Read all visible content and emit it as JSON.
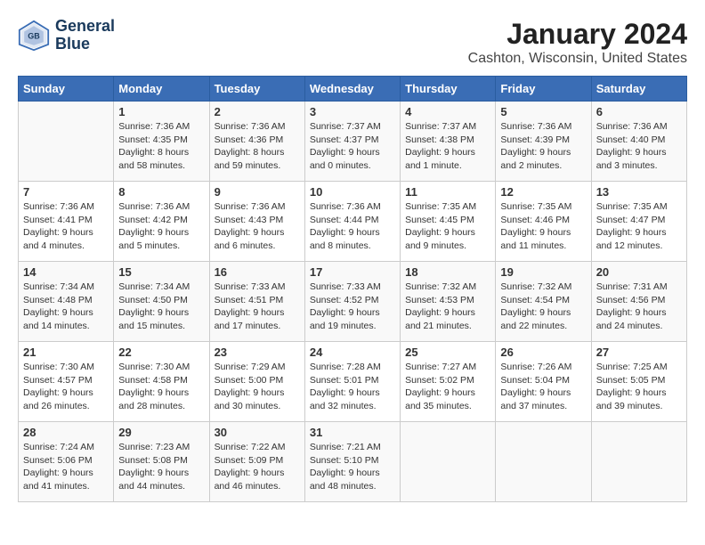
{
  "header": {
    "logo_line1": "General",
    "logo_line2": "Blue",
    "title": "January 2024",
    "subtitle": "Cashton, Wisconsin, United States"
  },
  "weekdays": [
    "Sunday",
    "Monday",
    "Tuesday",
    "Wednesday",
    "Thursday",
    "Friday",
    "Saturday"
  ],
  "weeks": [
    [
      {
        "day": "",
        "sunrise": "",
        "sunset": "",
        "daylight": ""
      },
      {
        "day": "1",
        "sunrise": "Sunrise: 7:36 AM",
        "sunset": "Sunset: 4:35 PM",
        "daylight": "Daylight: 8 hours and 58 minutes."
      },
      {
        "day": "2",
        "sunrise": "Sunrise: 7:36 AM",
        "sunset": "Sunset: 4:36 PM",
        "daylight": "Daylight: 8 hours and 59 minutes."
      },
      {
        "day": "3",
        "sunrise": "Sunrise: 7:37 AM",
        "sunset": "Sunset: 4:37 PM",
        "daylight": "Daylight: 9 hours and 0 minutes."
      },
      {
        "day": "4",
        "sunrise": "Sunrise: 7:37 AM",
        "sunset": "Sunset: 4:38 PM",
        "daylight": "Daylight: 9 hours and 1 minute."
      },
      {
        "day": "5",
        "sunrise": "Sunrise: 7:36 AM",
        "sunset": "Sunset: 4:39 PM",
        "daylight": "Daylight: 9 hours and 2 minutes."
      },
      {
        "day": "6",
        "sunrise": "Sunrise: 7:36 AM",
        "sunset": "Sunset: 4:40 PM",
        "daylight": "Daylight: 9 hours and 3 minutes."
      }
    ],
    [
      {
        "day": "7",
        "sunrise": "Sunrise: 7:36 AM",
        "sunset": "Sunset: 4:41 PM",
        "daylight": "Daylight: 9 hours and 4 minutes."
      },
      {
        "day": "8",
        "sunrise": "Sunrise: 7:36 AM",
        "sunset": "Sunset: 4:42 PM",
        "daylight": "Daylight: 9 hours and 5 minutes."
      },
      {
        "day": "9",
        "sunrise": "Sunrise: 7:36 AM",
        "sunset": "Sunset: 4:43 PM",
        "daylight": "Daylight: 9 hours and 6 minutes."
      },
      {
        "day": "10",
        "sunrise": "Sunrise: 7:36 AM",
        "sunset": "Sunset: 4:44 PM",
        "daylight": "Daylight: 9 hours and 8 minutes."
      },
      {
        "day": "11",
        "sunrise": "Sunrise: 7:35 AM",
        "sunset": "Sunset: 4:45 PM",
        "daylight": "Daylight: 9 hours and 9 minutes."
      },
      {
        "day": "12",
        "sunrise": "Sunrise: 7:35 AM",
        "sunset": "Sunset: 4:46 PM",
        "daylight": "Daylight: 9 hours and 11 minutes."
      },
      {
        "day": "13",
        "sunrise": "Sunrise: 7:35 AM",
        "sunset": "Sunset: 4:47 PM",
        "daylight": "Daylight: 9 hours and 12 minutes."
      }
    ],
    [
      {
        "day": "14",
        "sunrise": "Sunrise: 7:34 AM",
        "sunset": "Sunset: 4:48 PM",
        "daylight": "Daylight: 9 hours and 14 minutes."
      },
      {
        "day": "15",
        "sunrise": "Sunrise: 7:34 AM",
        "sunset": "Sunset: 4:50 PM",
        "daylight": "Daylight: 9 hours and 15 minutes."
      },
      {
        "day": "16",
        "sunrise": "Sunrise: 7:33 AM",
        "sunset": "Sunset: 4:51 PM",
        "daylight": "Daylight: 9 hours and 17 minutes."
      },
      {
        "day": "17",
        "sunrise": "Sunrise: 7:33 AM",
        "sunset": "Sunset: 4:52 PM",
        "daylight": "Daylight: 9 hours and 19 minutes."
      },
      {
        "day": "18",
        "sunrise": "Sunrise: 7:32 AM",
        "sunset": "Sunset: 4:53 PM",
        "daylight": "Daylight: 9 hours and 21 minutes."
      },
      {
        "day": "19",
        "sunrise": "Sunrise: 7:32 AM",
        "sunset": "Sunset: 4:54 PM",
        "daylight": "Daylight: 9 hours and 22 minutes."
      },
      {
        "day": "20",
        "sunrise": "Sunrise: 7:31 AM",
        "sunset": "Sunset: 4:56 PM",
        "daylight": "Daylight: 9 hours and 24 minutes."
      }
    ],
    [
      {
        "day": "21",
        "sunrise": "Sunrise: 7:30 AM",
        "sunset": "Sunset: 4:57 PM",
        "daylight": "Daylight: 9 hours and 26 minutes."
      },
      {
        "day": "22",
        "sunrise": "Sunrise: 7:30 AM",
        "sunset": "Sunset: 4:58 PM",
        "daylight": "Daylight: 9 hours and 28 minutes."
      },
      {
        "day": "23",
        "sunrise": "Sunrise: 7:29 AM",
        "sunset": "Sunset: 5:00 PM",
        "daylight": "Daylight: 9 hours and 30 minutes."
      },
      {
        "day": "24",
        "sunrise": "Sunrise: 7:28 AM",
        "sunset": "Sunset: 5:01 PM",
        "daylight": "Daylight: 9 hours and 32 minutes."
      },
      {
        "day": "25",
        "sunrise": "Sunrise: 7:27 AM",
        "sunset": "Sunset: 5:02 PM",
        "daylight": "Daylight: 9 hours and 35 minutes."
      },
      {
        "day": "26",
        "sunrise": "Sunrise: 7:26 AM",
        "sunset": "Sunset: 5:04 PM",
        "daylight": "Daylight: 9 hours and 37 minutes."
      },
      {
        "day": "27",
        "sunrise": "Sunrise: 7:25 AM",
        "sunset": "Sunset: 5:05 PM",
        "daylight": "Daylight: 9 hours and 39 minutes."
      }
    ],
    [
      {
        "day": "28",
        "sunrise": "Sunrise: 7:24 AM",
        "sunset": "Sunset: 5:06 PM",
        "daylight": "Daylight: 9 hours and 41 minutes."
      },
      {
        "day": "29",
        "sunrise": "Sunrise: 7:23 AM",
        "sunset": "Sunset: 5:08 PM",
        "daylight": "Daylight: 9 hours and 44 minutes."
      },
      {
        "day": "30",
        "sunrise": "Sunrise: 7:22 AM",
        "sunset": "Sunset: 5:09 PM",
        "daylight": "Daylight: 9 hours and 46 minutes."
      },
      {
        "day": "31",
        "sunrise": "Sunrise: 7:21 AM",
        "sunset": "Sunset: 5:10 PM",
        "daylight": "Daylight: 9 hours and 48 minutes."
      },
      {
        "day": "",
        "sunrise": "",
        "sunset": "",
        "daylight": ""
      },
      {
        "day": "",
        "sunrise": "",
        "sunset": "",
        "daylight": ""
      },
      {
        "day": "",
        "sunrise": "",
        "sunset": "",
        "daylight": ""
      }
    ]
  ]
}
